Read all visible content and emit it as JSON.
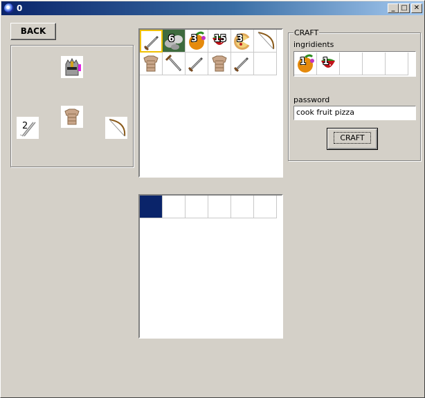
{
  "window": {
    "title": "0",
    "min_glyph": "_",
    "max_glyph": "□",
    "close_glyph": "✕"
  },
  "back_button": {
    "label": "BACK"
  },
  "equipment": {
    "slots": [
      {
        "name": "helmet",
        "icon": "helmet-icon",
        "qty": ""
      },
      {
        "name": "armor",
        "icon": "armor-icon",
        "qty": ""
      },
      {
        "name": "arrows",
        "icon": "arrows-icon",
        "qty": "2"
      },
      {
        "name": "bow",
        "icon": "bow-icon",
        "qty": ""
      }
    ]
  },
  "inventory": {
    "items": [
      {
        "icon": "dagger-icon",
        "qty": "",
        "selected": true
      },
      {
        "icon": "stones-icon",
        "qty": "6",
        "selected": false
      },
      {
        "icon": "fruit-icon",
        "qty": "3",
        "selected": false
      },
      {
        "icon": "strawberry-icon",
        "qty": "15",
        "selected": false
      },
      {
        "icon": "pizza-icon",
        "qty": "3",
        "selected": false
      },
      {
        "icon": "bow-icon",
        "qty": "",
        "selected": false
      },
      {
        "icon": "armor-icon",
        "qty": "",
        "selected": false
      },
      {
        "icon": "sword-icon",
        "qty": "",
        "selected": false
      },
      {
        "icon": "dagger-icon",
        "qty": "",
        "selected": false
      },
      {
        "icon": "armor-icon",
        "qty": "",
        "selected": false
      },
      {
        "icon": "dagger-icon",
        "qty": "",
        "selected": false
      },
      {
        "icon": "empty",
        "qty": "",
        "selected": false
      }
    ]
  },
  "bottom_grid": {
    "selected_index": 0,
    "cells": 6
  },
  "craft": {
    "group_label": "CRAFT",
    "ingredients_label": "ingridients",
    "ingredients": [
      {
        "icon": "fruit-icon",
        "qty": "1"
      },
      {
        "icon": "strawberry-icon",
        "qty": "1"
      },
      {
        "icon": "empty",
        "qty": ""
      },
      {
        "icon": "empty",
        "qty": ""
      },
      {
        "icon": "empty",
        "qty": ""
      }
    ],
    "password_label": "password",
    "password_value": "cook fruit pizza",
    "craft_button": "CRAFT"
  },
  "colors": {
    "selection": "#0a246a",
    "selected_border": "#f0c000",
    "titlebar": "#0a246a"
  }
}
